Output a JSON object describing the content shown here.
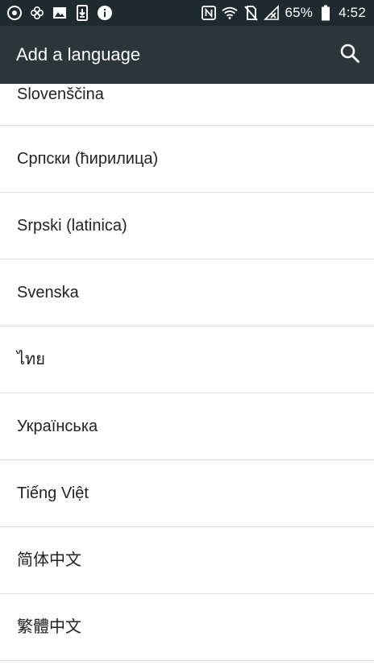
{
  "status_bar": {
    "left_icons": [
      "circle-app-icon",
      "flower-app-icon",
      "image-icon",
      "download-icon",
      "info-icon"
    ],
    "right_icons": [
      "nfc-icon",
      "wifi-icon",
      "no-sim-icon",
      "no-signal-icon",
      "battery-icon"
    ],
    "battery": "65%",
    "time": "4:52"
  },
  "app_bar": {
    "title": "Add a language",
    "search_icon": "search-icon"
  },
  "languages": [
    "Slovenščina",
    "Српски (ћирилица)",
    "Srpski (latinica)",
    "Svenska",
    "ไทย",
    "Українська",
    "Tiếng Việt",
    "简体中文",
    "繁體中文"
  ],
  "colors": {
    "status_bar_bg": "#1f2a2e",
    "app_bar_bg": "#2c3638",
    "list_bg": "#ffffff",
    "divider": "#dcdcdc",
    "text": "#222222"
  }
}
